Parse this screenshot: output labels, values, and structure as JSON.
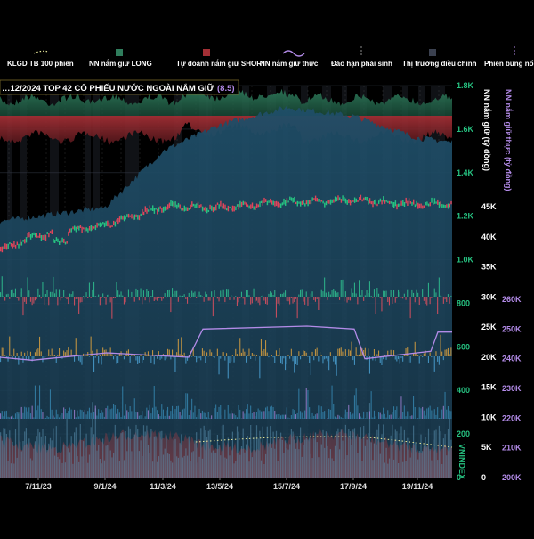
{
  "chart_data": {
    "type": "composite",
    "title": "…12/2024  TOP 42  CỔ PHIẾU NƯỚC NGOÀI NẮM GIỮ",
    "title_badge": "(8.5)",
    "legend": [
      {
        "key": "klgd",
        "label": "KLGD TB 100 phiên",
        "color": "#e8e89a",
        "kind": "dotted-line"
      },
      {
        "key": "long",
        "label": "NN nắm giữ LONG",
        "color": "#2f7d5c",
        "kind": "box"
      },
      {
        "key": "short",
        "label": "Tự doanh nắm giữ SHORT",
        "color": "#a32f35",
        "kind": "box"
      },
      {
        "key": "nn_real",
        "label": "NN nắm giữ thực",
        "color": "#b38be8",
        "kind": "line"
      },
      {
        "key": "expiry",
        "label": "Đáo hạn phái sinh",
        "color": "#8a8a8a",
        "kind": "dashed-vertical"
      },
      {
        "key": "correction",
        "label": "Thị trường điều chỉnh",
        "color": "#3b4150",
        "kind": "box"
      },
      {
        "key": "breakout",
        "label": "Phiên bùng nổ",
        "color": "#b38be8",
        "kind": "dashed-vertical"
      }
    ],
    "x_ticks": [
      "7/11/23",
      "9/1/24",
      "11/3/24",
      "13/5/24",
      "15/7/24",
      "17/9/24",
      "19/11/24"
    ],
    "axes": {
      "vnindex": {
        "label": "VNINDEX",
        "ticks": [
          "1.8K",
          "1.6K",
          "1.4K",
          "1.2K",
          "1.0K",
          "800",
          "600",
          "400",
          "200",
          "0"
        ],
        "range": [
          0,
          1800
        ]
      },
      "nn_long": {
        "label": "NN nắm giữ (tỷ đồng)",
        "ticks": [
          "45K",
          "40K",
          "35K",
          "30K",
          "25K",
          "20K",
          "15K",
          "10K",
          "5K",
          "0"
        ],
        "range": [
          0,
          45000
        ]
      },
      "nn_real": {
        "label": "NN nắm giữ thực (tỷ đồng)",
        "ticks": [
          "260K",
          "250K",
          "240K",
          "230K",
          "220K",
          "210K",
          "200K"
        ],
        "range": [
          200000,
          260000
        ]
      }
    },
    "series": [
      {
        "name": "VNINDEX",
        "unit": "points",
        "x": [
          "7/11/23",
          "9/1/24",
          "11/3/24",
          "13/5/24",
          "15/7/24",
          "17/9/24",
          "19/11/24",
          "12/2024"
        ],
        "y": [
          1110,
          1160,
          1245,
          1240,
          1265,
          1272,
          1255,
          1255
        ]
      },
      {
        "name": "NN nắm giữ",
        "unit": "tỷ đồng",
        "x": [
          "7/11/23",
          "9/1/24",
          "11/3/24",
          "13/5/24",
          "15/7/24",
          "17/9/24",
          "19/11/24",
          "12/2024"
        ],
        "y": [
          30000,
          31000,
          37500,
          40500,
          42500,
          41500,
          39000,
          38500
        ]
      },
      {
        "name": "NN nắm giữ thực",
        "unit": "tỷ đồng",
        "x": [
          "7/11/23",
          "9/1/24",
          "11/3/24",
          "13/5/24",
          "15/7/24",
          "17/9/24",
          "19/11/24",
          "12/2024"
        ],
        "y": [
          240500,
          242000,
          244000,
          250000,
          249000,
          249500,
          241500,
          249000
        ]
      }
    ]
  }
}
